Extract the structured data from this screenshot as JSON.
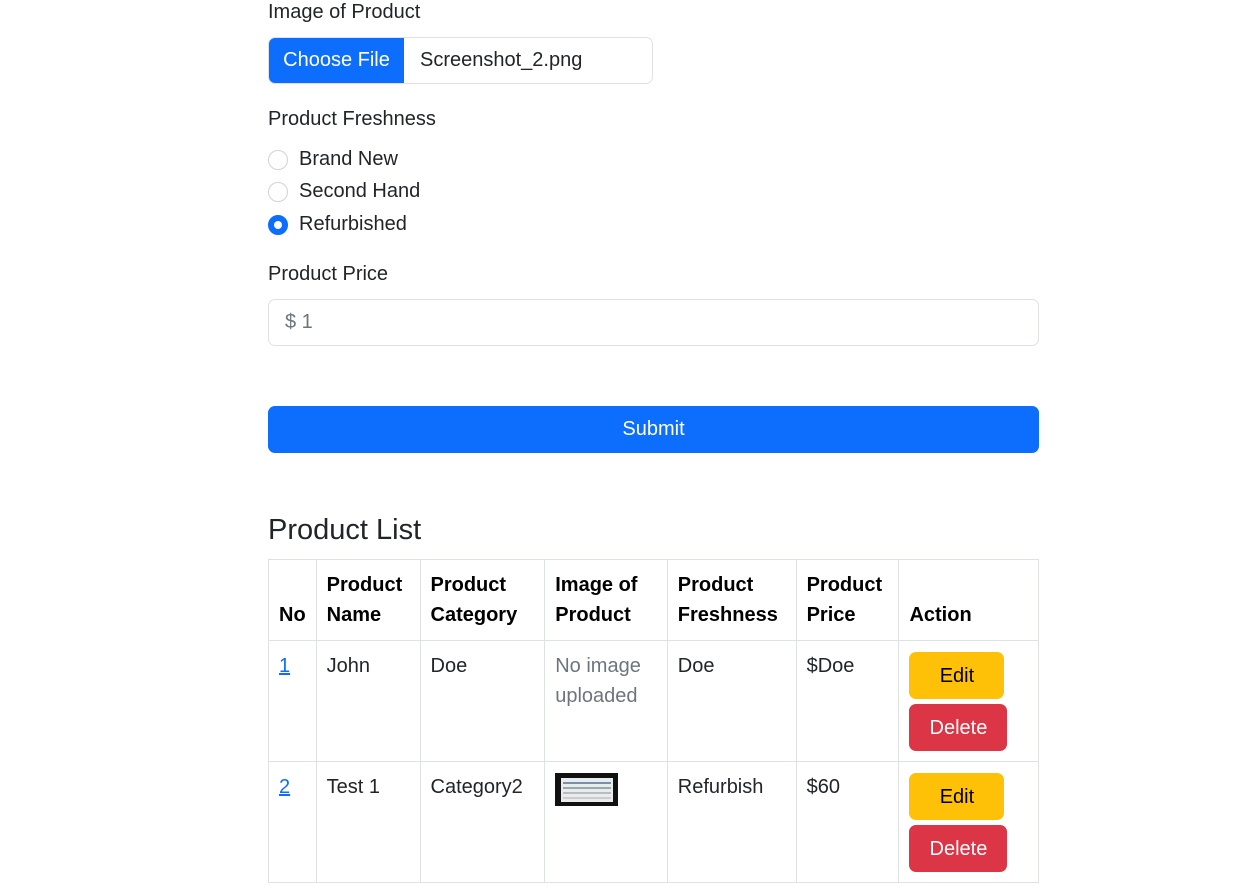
{
  "form": {
    "image_label": "Image of Product",
    "choose_file_label": "Choose File",
    "file_name": "Screenshot_2.png",
    "freshness_label": "Product Freshness",
    "freshness_options": [
      {
        "label": "Brand New",
        "checked": false
      },
      {
        "label": "Second Hand",
        "checked": false
      },
      {
        "label": "Refurbished",
        "checked": true
      }
    ],
    "price_label": "Product Price",
    "price_value": "$ 1",
    "submit_label": "Submit"
  },
  "product_list": {
    "title": "Product List",
    "columns": [
      "No",
      "Product Name",
      "Product Category",
      "Image of Product",
      "Product Freshness",
      "Product Price",
      "Action"
    ],
    "rows": [
      {
        "no": "1",
        "name": "John",
        "category": "Doe",
        "image": "No image uploaded",
        "freshness": "Doe",
        "price": "$Doe",
        "edit": "Edit",
        "delete": "Delete"
      },
      {
        "no": "2",
        "name": "Test 1",
        "category": "Category2",
        "image": "",
        "freshness": "Refurbish",
        "price": "$60",
        "edit": "Edit",
        "delete": "Delete"
      }
    ]
  },
  "colors": {
    "primary": "#0d6efd",
    "warning": "#ffc107",
    "danger": "#dc3545"
  }
}
